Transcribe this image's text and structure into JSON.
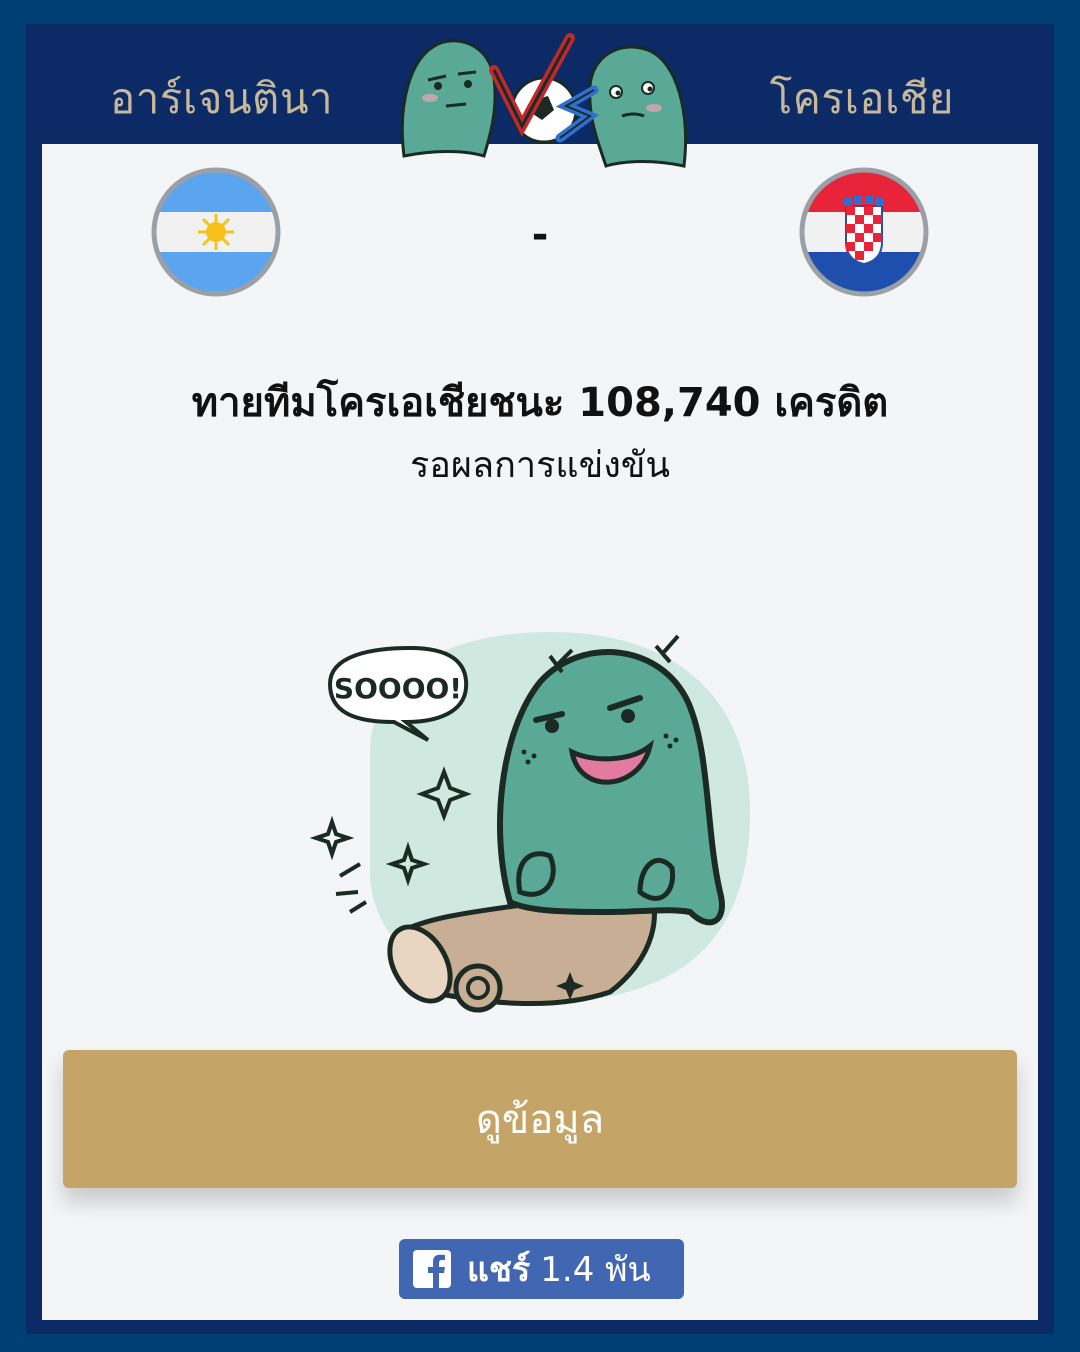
{
  "header": {
    "team_left": "อาร์เจนตินา",
    "team_right": "โครเอเชีย"
  },
  "match": {
    "score": "-",
    "prediction": "ทายทีมโครเอเชียชนะ 108,740 เครดิต",
    "status": "รอผลการแข่งขัน"
  },
  "mascot": {
    "speech": "SOOOO!"
  },
  "details_button": {
    "label": "ดูข้อมูล"
  },
  "share": {
    "label": "แชร์",
    "count": "1.4 พัน"
  },
  "colors": {
    "background": "#003f73",
    "frame": "#0b2a66",
    "panel": "#f3f5f7",
    "team_name": "#c8b89a",
    "button": "#c4a567",
    "facebook": "#4267b2",
    "mascot_green": "#5aa896"
  }
}
